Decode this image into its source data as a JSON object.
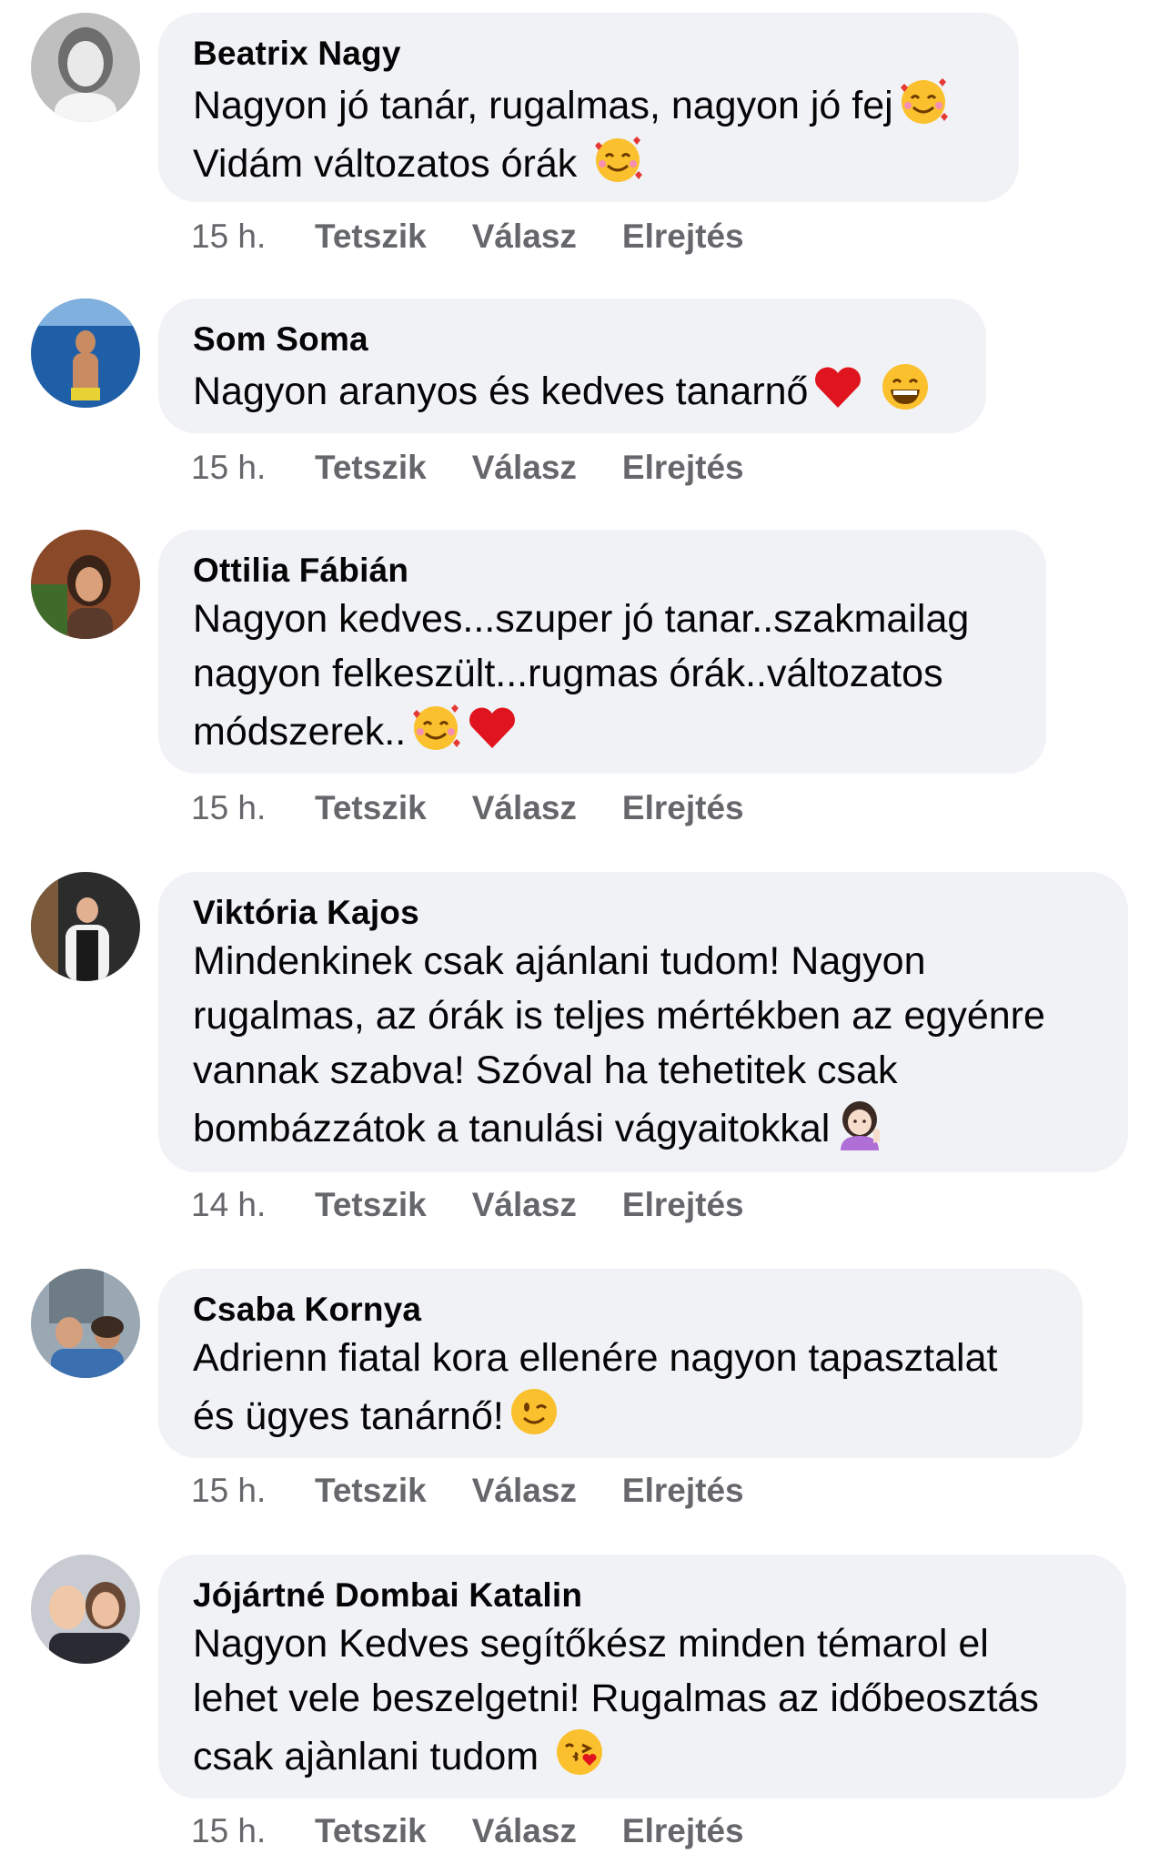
{
  "labels": {
    "like": "Tetszik",
    "reply": "Válasz",
    "hide": "Elrejtés"
  },
  "comments": [
    {
      "author": "Beatrix Nagy",
      "text_lines": [
        "Nagyon jó tanár, rugalmas, nagyon jó fej",
        "Vidám változatos órák"
      ],
      "time": "15 h.",
      "emojis": [
        "smiling-face-with-hearts",
        "smiling-face-with-hearts"
      ]
    },
    {
      "author": "Som Soma",
      "text_lines": [
        "Nagyon aranyos és kedves tanarnő"
      ],
      "time": "15 h.",
      "emojis": [
        "red-heart",
        "grinning-face"
      ]
    },
    {
      "author": "Ottilia Fábián",
      "text_lines": [
        "Nagyon kedves...szuper jó tanar..szakmailag",
        "nagyon felkeszült...rugmas órák..változatos",
        "módszerek.."
      ],
      "time": "15 h.",
      "emojis": [
        "smiling-face-with-hearts",
        "red-heart"
      ]
    },
    {
      "author": "Viktória Kajos",
      "text_lines": [
        "Mindenkinek csak ajánlani tudom! Nagyon",
        "rugalmas, az órák is teljes mértékben az egyénre",
        "vannak szabva! Szóval ha tehetitek csak",
        "bombázzátok a tanulási vágyaitokkal"
      ],
      "time": "14 h.",
      "emojis": [
        "person-tipping-hand"
      ]
    },
    {
      "author": "Csaba Kornya",
      "text_lines": [
        "Adrienn fiatal kora ellenére nagyon tapasztalat",
        "és ügyes tanárnő!"
      ],
      "time": "15 h.",
      "emojis": [
        "winking-face"
      ]
    },
    {
      "author": "Jójártné Dombai Katalin",
      "text_lines": [
        "Nagyon Kedves segítőkész minden témarol el",
        "lehet vele beszelgetni! Rugalmas az időbeosztás",
        "csak ajànlani tudom"
      ],
      "time": "15 h.",
      "emojis": [
        "face-blowing-kiss"
      ]
    }
  ],
  "colors": {
    "bubble": "#f0f2f5",
    "meta": "#65676b",
    "text": "#050505"
  }
}
